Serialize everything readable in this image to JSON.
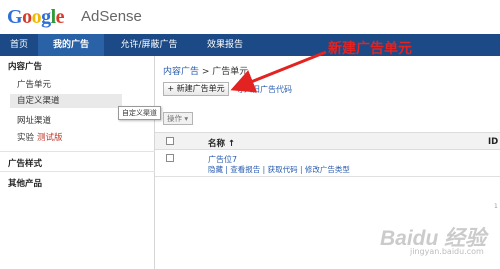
{
  "header": {
    "logo": [
      "G",
      "o",
      "o",
      "g",
      "l",
      "e"
    ],
    "product": "AdSense"
  },
  "nav": {
    "items": [
      {
        "label": "首页"
      },
      {
        "label": "我的广告"
      },
      {
        "label": "允许/屏蔽广告"
      },
      {
        "label": "效果报告"
      }
    ],
    "active_index": 1,
    "colors": {
      "bar": "#1b4a86",
      "active": "#2a62a8"
    }
  },
  "sidebar": {
    "section_content": "内容广告",
    "items": [
      {
        "label": "广告单元"
      },
      {
        "label": "自定义渠道"
      },
      {
        "label": "网址渠道"
      },
      {
        "label": "实验",
        "badge": "测试版"
      }
    ],
    "section_style": "广告样式",
    "section_other": "其他产品"
  },
  "tooltip": "自定义渠道",
  "breadcrumb": {
    "root": "内容广告",
    "separator": " > ",
    "current": "广告单元"
  },
  "toolbar": {
    "new_button": "+ 新建广告单元",
    "import_link": "导入旧广告代码",
    "ops_button": "操作 ▾"
  },
  "table": {
    "col_name": "名称 ↑",
    "col_id": "ID"
  },
  "row": {
    "title": "广告位7",
    "actions": "隐藏 | 查看报告 | 获取代码 | 修改广告类型"
  },
  "annotation": {
    "text": "新建广告单元",
    "color": "#e32222"
  },
  "edge_mark": "1",
  "watermark": {
    "text": "Baidu 经验",
    "sub": "jingyan.baidu.com"
  }
}
